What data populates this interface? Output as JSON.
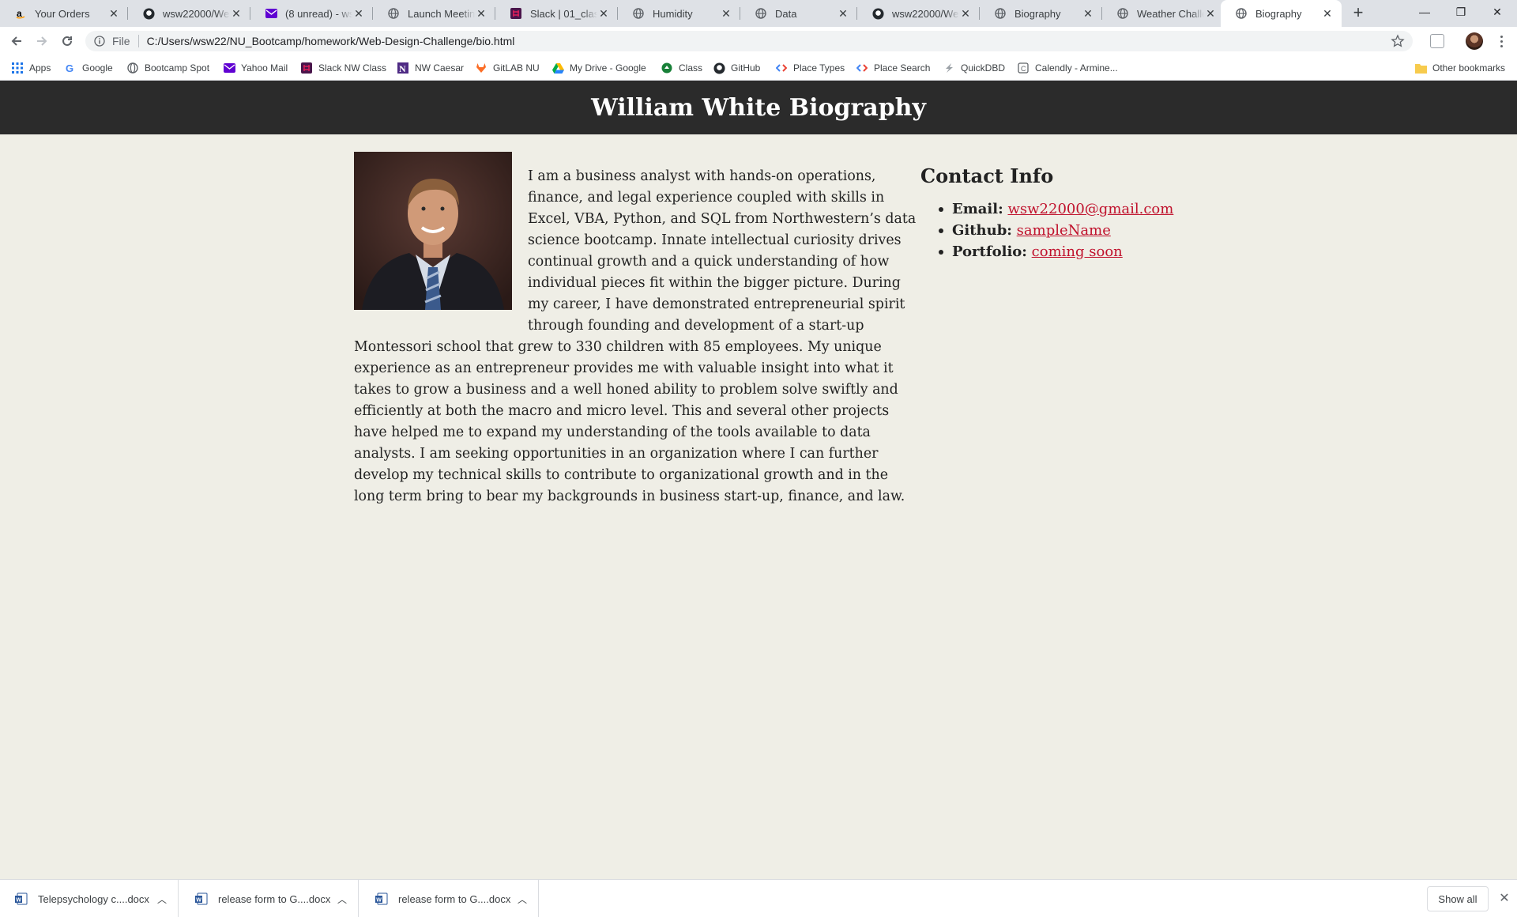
{
  "browser": {
    "tabs": [
      {
        "title": "Your Orders",
        "icon": "amazon-icon"
      },
      {
        "title": "wsw22000/Web-",
        "icon": "github-icon"
      },
      {
        "title": "(8 unread) - wsw",
        "icon": "yahoo-mail-icon"
      },
      {
        "title": "Launch Meeting",
        "icon": "globe-icon"
      },
      {
        "title": "Slack | 01_class_a",
        "icon": "slack-icon"
      },
      {
        "title": "Humidity",
        "icon": "globe-icon"
      },
      {
        "title": "Data",
        "icon": "globe-icon"
      },
      {
        "title": "wsw22000/Web-",
        "icon": "github-icon"
      },
      {
        "title": "Biography",
        "icon": "globe-icon"
      },
      {
        "title": "Weather Challen",
        "icon": "globe-icon"
      },
      {
        "title": "Biography",
        "icon": "globe-icon",
        "active": true
      }
    ],
    "address": {
      "scheme": "File",
      "url": "C:/Users/wsw22/NU_Bootcamp/homework/Web-Design-Challenge/bio.html"
    },
    "bookmarks": [
      {
        "label": "Apps",
        "icon": "apps-grid-icon"
      },
      {
        "label": "Google",
        "icon": "google-icon"
      },
      {
        "label": "Bootcamp Spot",
        "icon": "globe-icon"
      },
      {
        "label": "Yahoo Mail",
        "icon": "yahoo-mail-icon"
      },
      {
        "label": "Slack NW Class",
        "icon": "slack-icon"
      },
      {
        "label": "NW Caesar",
        "icon": "northwestern-icon"
      },
      {
        "label": "GitLAB NU",
        "icon": "gitlab-icon"
      },
      {
        "label": "My Drive - Google",
        "icon": "google-drive-icon"
      },
      {
        "label": "Class",
        "icon": "recycle-icon"
      },
      {
        "label": "GitHub",
        "icon": "github-icon"
      },
      {
        "label": "Place Types",
        "icon": "code-icon"
      },
      {
        "label": "Place Search",
        "icon": "code-icon"
      },
      {
        "label": "QuickDBD",
        "icon": "quickdbd-icon"
      },
      {
        "label": "Calendly - Armine...",
        "icon": "calendly-icon"
      }
    ],
    "other_bookmarks": "Other bookmarks"
  },
  "page": {
    "header_title": "William White Biography",
    "bio_text": "I am a business analyst with hands-on operations, finance, and legal experience coupled with skills in Excel, VBA, Python, and SQL from Northwestern’s data science bootcamp. Innate intellectual curiosity drives continual growth and a quick understanding of how individual pieces fit within the bigger picture. During my career, I have demonstrated entrepreneurial spirit through founding and development of a start-up Montessori school that grew to 330 children with 85 employees. My unique experience as an entrepreneur provides me with valuable insight into what it takes to grow a business and a well honed ability to problem solve swiftly and efficiently at both the macro and micro level. This and several other projects have helped me to expand my understanding of the tools available to data analysts. I am seeking opportunities in an organization where I can further develop my technical skills to contribute to organizational growth and in the long term bring to bear my backgrounds in business start-up, finance, and law.",
    "contact": {
      "heading": "Contact Info",
      "items": [
        {
          "label": "Email:",
          "value": "wsw22000@gmail.com"
        },
        {
          "label": "Github:",
          "value": "sampleName"
        },
        {
          "label": "Portfolio:",
          "value": "coming soon"
        }
      ]
    },
    "colors": {
      "header_bg": "#2b2b2b",
      "page_bg": "#efeee6",
      "link": "#c0122d"
    }
  },
  "downloads": {
    "items": [
      {
        "name": "Telepsychology c....docx"
      },
      {
        "name": "release form to G....docx"
      },
      {
        "name": "release form to G....docx"
      }
    ],
    "show_all": "Show all"
  }
}
